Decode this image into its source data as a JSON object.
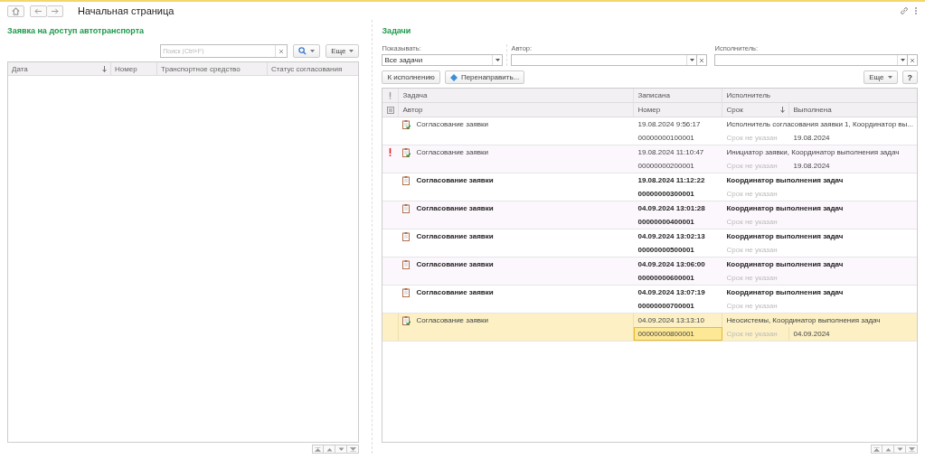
{
  "window": {
    "title": "Начальная страница"
  },
  "requests": {
    "title": "Заявка на доступ автотранспорта",
    "search": {
      "placeholder": "Поиск (Ctrl+F)"
    },
    "more_button": "Еще",
    "columns": [
      {
        "label": "Дата",
        "sorted": true
      },
      {
        "label": "Номер",
        "sorted": false
      },
      {
        "label": "Транспортное средство",
        "sorted": false
      },
      {
        "label": "Статус согласования",
        "sorted": false
      }
    ]
  },
  "tasks": {
    "title": "Задачи",
    "filters": [
      {
        "label": "Показывать:",
        "value": "Все задачи",
        "clearable": false
      },
      {
        "label": "Автор:",
        "clearable": true
      },
      {
        "label": "Исполнитель:",
        "clearable": true
      }
    ],
    "buttons": [
      "К исполнению",
      "Перенаправить..."
    ],
    "more_button": "Еще",
    "help_button": "?",
    "header_top": [
      "Задача",
      "Записана",
      "Исполнитель"
    ],
    "header_bottom": [
      "Автор",
      "Номер",
      "Срок",
      "Выполнена"
    ],
    "rows": [
      {
        "task": "Согласование заявки",
        "date": "19.08.2024 9:56:17",
        "executor": "Исполнитель согласования заявки 1, Координатор вы...",
        "number": "00000000100001",
        "due": "Срок не указан",
        "done": "19.08.2024",
        "important": false,
        "completed": true,
        "unread": false,
        "selected": false
      },
      {
        "task": "Согласование заявки",
        "date": "19.08.2024 11:10:47",
        "executor": "Инициатор заявки, Координатор выполнения задач",
        "number": "00000000200001",
        "due": "Срок не указан",
        "done": "19.08.2024",
        "important": true,
        "completed": true,
        "unread": false,
        "selected": false
      },
      {
        "task": "Согласование заявки",
        "date": "19.08.2024 11:12:22",
        "executor": "Координатор выполнения задач",
        "number": "00000000300001",
        "due": "Срок не указан",
        "important": false,
        "completed": false,
        "unread": true,
        "selected": false
      },
      {
        "task": "Согласование заявки",
        "date": "04.09.2024 13:01:28",
        "executor": "Координатор выполнения задач",
        "number": "00000000400001",
        "due": "Срок не указан",
        "important": false,
        "completed": false,
        "unread": true,
        "selected": false
      },
      {
        "task": "Согласование заявки",
        "date": "04.09.2024 13:02:13",
        "executor": "Координатор выполнения задач",
        "number": "00000000500001",
        "due": "Срок не указан",
        "important": false,
        "completed": false,
        "unread": true,
        "selected": false
      },
      {
        "task": "Согласование заявки",
        "date": "04.09.2024 13:06:00",
        "executor": "Координатор выполнения задач",
        "number": "00000000600001",
        "due": "Срок не указан",
        "important": false,
        "completed": false,
        "unread": true,
        "selected": false
      },
      {
        "task": "Согласование заявки",
        "date": "04.09.2024 13:07:19",
        "executor": "Координатор выполнения задач",
        "number": "00000000700001",
        "due": "Срок не указан",
        "important": false,
        "completed": false,
        "unread": true,
        "selected": false
      },
      {
        "task": "Согласование заявки",
        "date": "04.09.2024 13:13:10",
        "executor": "Неосистемы, Координатор выполнения задач",
        "number": "00000000800001",
        "due": "Срок не указан",
        "done": "04.09.2024",
        "important": false,
        "completed": true,
        "unread": false,
        "selected": true
      }
    ]
  }
}
